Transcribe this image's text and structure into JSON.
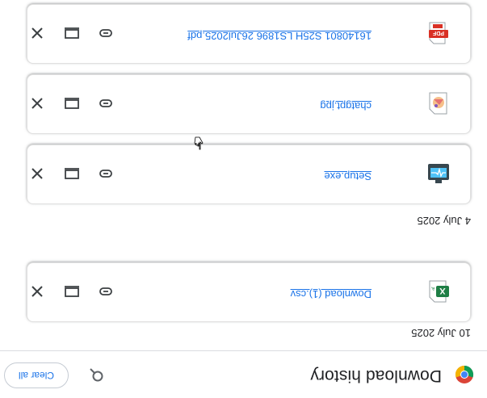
{
  "header": {
    "title": "Download history",
    "clear_all_label": "Clear all",
    "search_icon": "search-icon",
    "browser_logo": "chrome-logo-icon"
  },
  "groups": [
    {
      "date": "10 July 2025",
      "items": [
        {
          "name": "Download (1).csv",
          "icon": "excel-csv-file-icon"
        }
      ]
    },
    {
      "date": "4 July 2025",
      "items": [
        {
          "name": "Setup.exe",
          "icon": "installer-exe-file-icon"
        },
        {
          "name": "chatgpt.jpg",
          "icon": "image-jpg-file-icon"
        },
        {
          "name": "16140801 S25H LS1896 26Jul2025.pdf",
          "icon": "pdf-file-icon"
        }
      ]
    }
  ],
  "actions": {
    "copy_link_icon": "link-icon",
    "show_in_folder_icon": "laptop-folder-icon",
    "remove_icon": "close-icon"
  },
  "colors": {
    "accent": "#1a73e8",
    "text": "#202124",
    "border": "#dadce0"
  }
}
